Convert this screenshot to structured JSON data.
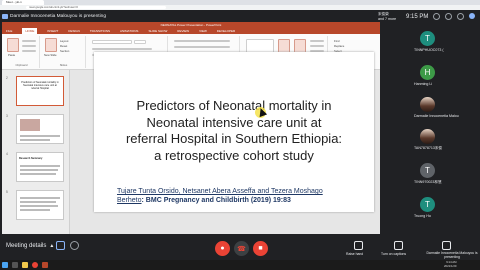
{
  "browser": {
    "tab_title": "Meet - yki-n",
    "url": "meet.google.com/ski-ckmf-ykr?authuser=0"
  },
  "meet": {
    "presenter_banner": "Darmalie Innocenetia Malouyou is presenting",
    "user": {
      "line1": "宋俊榮",
      "line2": "and 7 more"
    },
    "clock": "9:15 PM"
  },
  "powerpoint": {
    "window_title": "NEONATAL Power Presentation - PowerPoint",
    "menu": [
      "FILE",
      "HOME",
      "INSERT",
      "DESIGN",
      "TRANSITIONS",
      "ANIMATIONS",
      "SLIDE SHOW",
      "REVIEW",
      "VIEW",
      "DEVELOPER"
    ],
    "ribbon_groups": [
      "Clipboard",
      "Slides",
      "Font",
      "Paragraph",
      "Drawing",
      "Editing"
    ],
    "ribbon_items": {
      "paste": "Paste",
      "new_slide": "New Slide",
      "layout": "Layout",
      "reset": "Reset",
      "section": "Section",
      "find": "Find",
      "replace": "Replace",
      "select": "Select"
    },
    "thumbnails": [
      {
        "num": "2",
        "text": "Predictors of Neonatal mortality in Neonatal intensive care unit at referral Hospital"
      },
      {
        "num": "3",
        "text": ""
      },
      {
        "num": "4",
        "text": "Research Summary"
      },
      {
        "num": "5",
        "text": ""
      }
    ],
    "slide": {
      "title_lines": [
        "Predictors of Neonatal mortality in",
        "Neonatal intensive care unit at",
        "referral Hospital in Southern Ethiopia:",
        "a retrospective cohort study"
      ],
      "authors_line1": "Tujare Tunta Orsido, Netsanet Abera Asseffa and Tezera Moshago",
      "authors_line2_u": "Berheto",
      "authors_journal": ": BMC Pregnancy and Childbirth (2019) 19:83"
    }
  },
  "participants": [
    {
      "initial": "T",
      "name": "TINNPHUOC073 (",
      "color": "#1e8e7e"
    },
    {
      "initial": "H",
      "name": "Hanming Li",
      "color": "#3d9a47"
    },
    {
      "initial": "",
      "name": "Darmalie Innocenetia Malou",
      "color": "photo"
    },
    {
      "initial": "",
      "name": "TAN7878713宋俊",
      "color": "photo"
    },
    {
      "initial": "T",
      "name": "TINN970023林慧",
      "color": "#5f6368"
    },
    {
      "initial": "T",
      "name": "Truong Ho",
      "color": "#1e8e7e"
    }
  ],
  "bottom": {
    "meeting_details": "Meeting details",
    "raise_hand": "Raise hand",
    "turn_on_captions": "Turn on captions",
    "presenting": "Darmalie Innocenetia Malouyou is presenting"
  },
  "taskbar": {
    "time": "9:14 AM",
    "date": "2021/1/20"
  }
}
